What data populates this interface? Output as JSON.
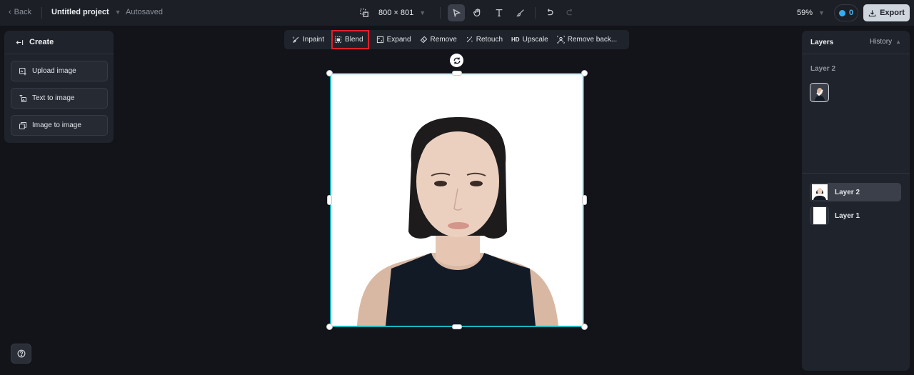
{
  "topbar": {
    "back_label": "Back",
    "project_title": "Untitled project",
    "autosave_status": "Autosaved",
    "canvas_size": "800 × 801",
    "zoom_level": "59%",
    "credits": "0",
    "export_label": "Export",
    "tools": [
      {
        "name": "select",
        "active": true
      },
      {
        "name": "hand",
        "active": false
      },
      {
        "name": "text",
        "active": false
      },
      {
        "name": "brush",
        "active": false
      }
    ]
  },
  "left_panel": {
    "header": "Create",
    "buttons": [
      {
        "label": "Upload image"
      },
      {
        "label": "Text to image"
      },
      {
        "label": "Image to image"
      }
    ]
  },
  "tool_strip": {
    "items": [
      {
        "label": "Inpaint"
      },
      {
        "label": "Blend",
        "highlighted": true
      },
      {
        "label": "Expand"
      },
      {
        "label": "Remove"
      },
      {
        "label": "Retouch"
      },
      {
        "label": "Upscale",
        "prefix": "HD"
      },
      {
        "label": "Remove back..."
      }
    ]
  },
  "right_panel": {
    "tab_layers": "Layers",
    "tab_history": "History",
    "selected_layer_label": "Layer 2",
    "layers": [
      {
        "label": "Layer 2",
        "active": true
      },
      {
        "label": "Layer 1",
        "active": false
      }
    ]
  },
  "colors": {
    "selection": "#19b7c0",
    "highlight": "#e0202a",
    "accent": "#33aef0"
  }
}
